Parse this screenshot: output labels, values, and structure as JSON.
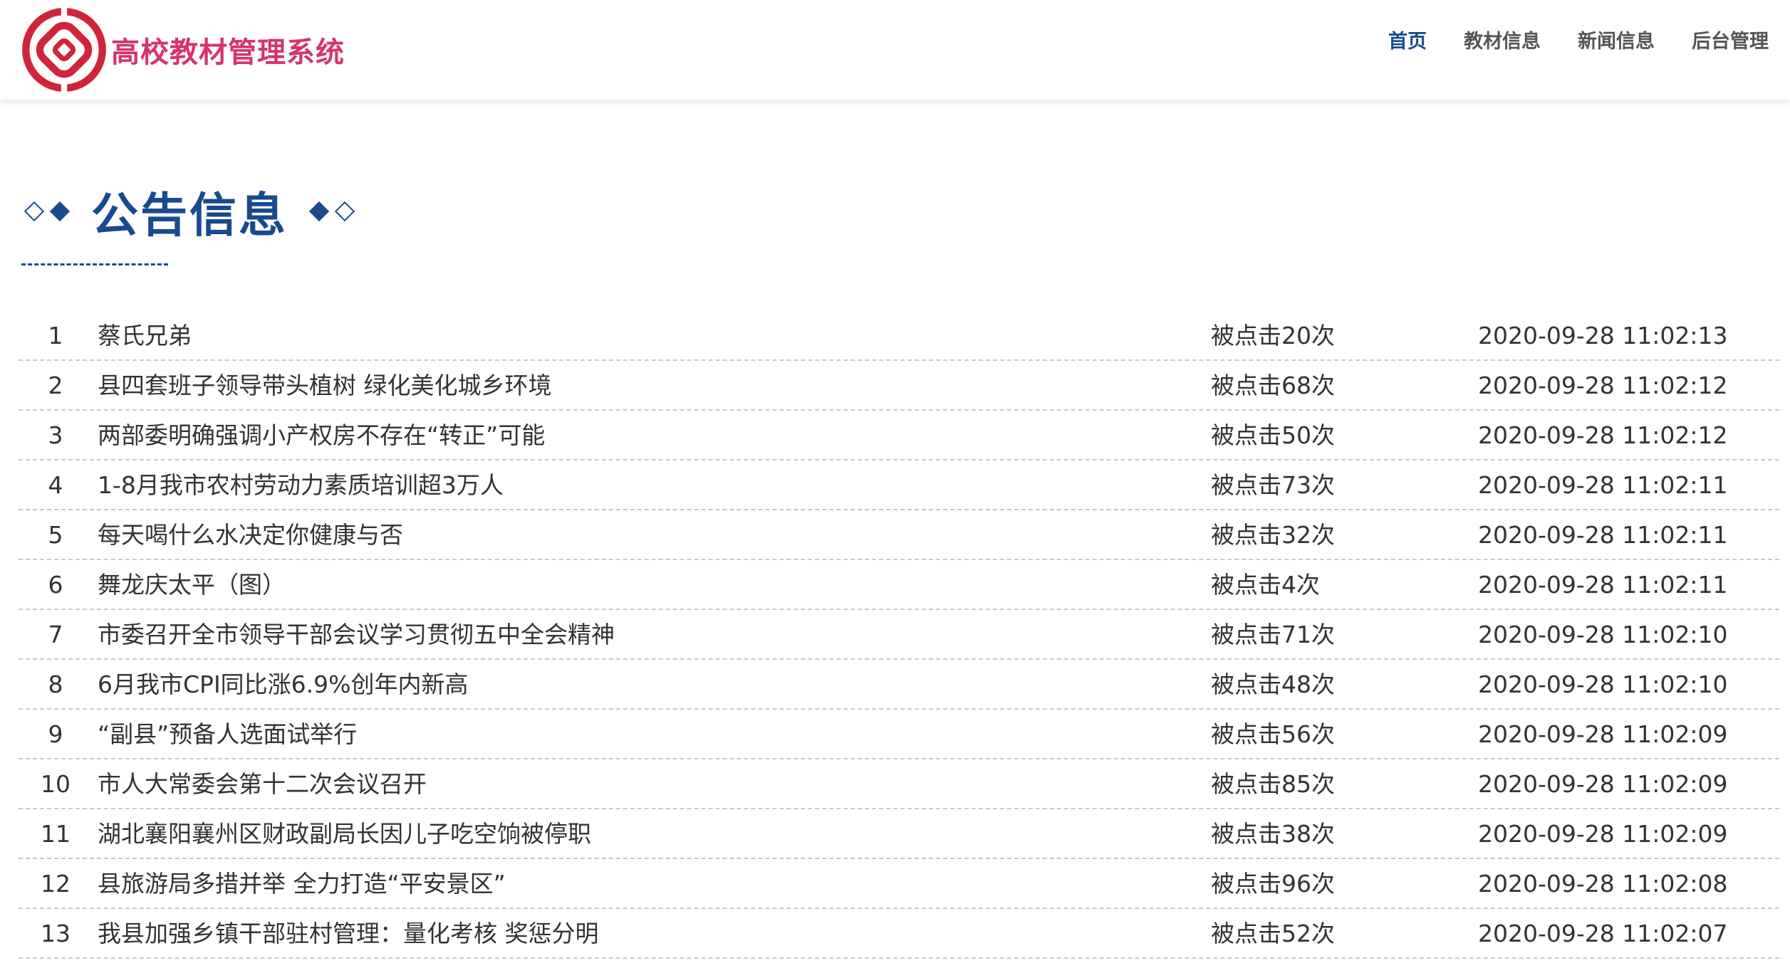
{
  "header": {
    "site_title": "高校教材管理系统",
    "logo_icon": "red-chain-ring-logo-icon",
    "brand_color": "#d6336c",
    "nav": [
      {
        "label": "首页",
        "active": true
      },
      {
        "label": "教材信息",
        "active": false
      },
      {
        "label": "新闻信息",
        "active": false
      },
      {
        "label": "后台管理",
        "active": false
      }
    ]
  },
  "section": {
    "title": "公告信息",
    "accent_color": "#1a4c8c"
  },
  "click_prefix": "被点击",
  "click_suffix": "次",
  "notices": [
    {
      "idx": "1",
      "title": "蔡氏兄弟",
      "clicks": 20,
      "date": "2020-09-28 11:02:13"
    },
    {
      "idx": "2",
      "title": "县四套班子领导带头植树 绿化美化城乡环境",
      "clicks": 68,
      "date": "2020-09-28 11:02:12"
    },
    {
      "idx": "3",
      "title": "两部委明确强调小产权房不存在“转正”可能",
      "clicks": 50,
      "date": "2020-09-28 11:02:12"
    },
    {
      "idx": "4",
      "title": "1-8月我市农村劳动力素质培训超3万人",
      "clicks": 73,
      "date": "2020-09-28 11:02:11"
    },
    {
      "idx": "5",
      "title": "每天喝什么水决定你健康与否",
      "clicks": 32,
      "date": "2020-09-28 11:02:11"
    },
    {
      "idx": "6",
      "title": "舞龙庆太平（图）",
      "clicks": 4,
      "date": "2020-09-28 11:02:11"
    },
    {
      "idx": "7",
      "title": "市委召开全市领导干部会议学习贯彻五中全会精神",
      "clicks": 71,
      "date": "2020-09-28 11:02:10"
    },
    {
      "idx": "8",
      "title": "6月我市CPI同比涨6.9%创年内新高",
      "clicks": 48,
      "date": "2020-09-28 11:02:10"
    },
    {
      "idx": "9",
      "title": "“副县”预备人选面试举行",
      "clicks": 56,
      "date": "2020-09-28 11:02:09"
    },
    {
      "idx": "10",
      "title": "市人大常委会第十二次会议召开",
      "clicks": 85,
      "date": "2020-09-28 11:02:09"
    },
    {
      "idx": "11",
      "title": "湖北襄阳襄州区财政副局长因儿子吃空饷被停职",
      "clicks": 38,
      "date": "2020-09-28 11:02:09"
    },
    {
      "idx": "12",
      "title": "县旅游局多措并举 全力打造“平安景区”",
      "clicks": 96,
      "date": "2020-09-28 11:02:08"
    },
    {
      "idx": "13",
      "title": "我县加强乡镇干部驻村管理：量化考核 奖惩分明",
      "clicks": 52,
      "date": "2020-09-28 11:02:07"
    }
  ]
}
